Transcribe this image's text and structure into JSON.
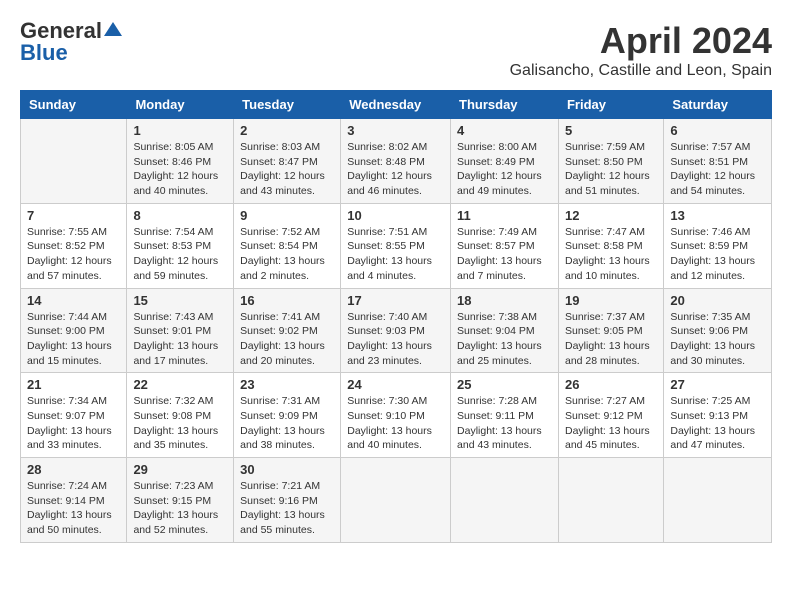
{
  "header": {
    "logo_general": "General",
    "logo_blue": "Blue",
    "month": "April 2024",
    "location": "Galisancho, Castille and Leon, Spain"
  },
  "days_of_week": [
    "Sunday",
    "Monday",
    "Tuesday",
    "Wednesday",
    "Thursday",
    "Friday",
    "Saturday"
  ],
  "weeks": [
    [
      {
        "day": "",
        "info": ""
      },
      {
        "day": "1",
        "info": "Sunrise: 8:05 AM\nSunset: 8:46 PM\nDaylight: 12 hours\nand 40 minutes."
      },
      {
        "day": "2",
        "info": "Sunrise: 8:03 AM\nSunset: 8:47 PM\nDaylight: 12 hours\nand 43 minutes."
      },
      {
        "day": "3",
        "info": "Sunrise: 8:02 AM\nSunset: 8:48 PM\nDaylight: 12 hours\nand 46 minutes."
      },
      {
        "day": "4",
        "info": "Sunrise: 8:00 AM\nSunset: 8:49 PM\nDaylight: 12 hours\nand 49 minutes."
      },
      {
        "day": "5",
        "info": "Sunrise: 7:59 AM\nSunset: 8:50 PM\nDaylight: 12 hours\nand 51 minutes."
      },
      {
        "day": "6",
        "info": "Sunrise: 7:57 AM\nSunset: 8:51 PM\nDaylight: 12 hours\nand 54 minutes."
      }
    ],
    [
      {
        "day": "7",
        "info": "Sunrise: 7:55 AM\nSunset: 8:52 PM\nDaylight: 12 hours\nand 57 minutes."
      },
      {
        "day": "8",
        "info": "Sunrise: 7:54 AM\nSunset: 8:53 PM\nDaylight: 12 hours\nand 59 minutes."
      },
      {
        "day": "9",
        "info": "Sunrise: 7:52 AM\nSunset: 8:54 PM\nDaylight: 13 hours\nand 2 minutes."
      },
      {
        "day": "10",
        "info": "Sunrise: 7:51 AM\nSunset: 8:55 PM\nDaylight: 13 hours\nand 4 minutes."
      },
      {
        "day": "11",
        "info": "Sunrise: 7:49 AM\nSunset: 8:57 PM\nDaylight: 13 hours\nand 7 minutes."
      },
      {
        "day": "12",
        "info": "Sunrise: 7:47 AM\nSunset: 8:58 PM\nDaylight: 13 hours\nand 10 minutes."
      },
      {
        "day": "13",
        "info": "Sunrise: 7:46 AM\nSunset: 8:59 PM\nDaylight: 13 hours\nand 12 minutes."
      }
    ],
    [
      {
        "day": "14",
        "info": "Sunrise: 7:44 AM\nSunset: 9:00 PM\nDaylight: 13 hours\nand 15 minutes."
      },
      {
        "day": "15",
        "info": "Sunrise: 7:43 AM\nSunset: 9:01 PM\nDaylight: 13 hours\nand 17 minutes."
      },
      {
        "day": "16",
        "info": "Sunrise: 7:41 AM\nSunset: 9:02 PM\nDaylight: 13 hours\nand 20 minutes."
      },
      {
        "day": "17",
        "info": "Sunrise: 7:40 AM\nSunset: 9:03 PM\nDaylight: 13 hours\nand 23 minutes."
      },
      {
        "day": "18",
        "info": "Sunrise: 7:38 AM\nSunset: 9:04 PM\nDaylight: 13 hours\nand 25 minutes."
      },
      {
        "day": "19",
        "info": "Sunrise: 7:37 AM\nSunset: 9:05 PM\nDaylight: 13 hours\nand 28 minutes."
      },
      {
        "day": "20",
        "info": "Sunrise: 7:35 AM\nSunset: 9:06 PM\nDaylight: 13 hours\nand 30 minutes."
      }
    ],
    [
      {
        "day": "21",
        "info": "Sunrise: 7:34 AM\nSunset: 9:07 PM\nDaylight: 13 hours\nand 33 minutes."
      },
      {
        "day": "22",
        "info": "Sunrise: 7:32 AM\nSunset: 9:08 PM\nDaylight: 13 hours\nand 35 minutes."
      },
      {
        "day": "23",
        "info": "Sunrise: 7:31 AM\nSunset: 9:09 PM\nDaylight: 13 hours\nand 38 minutes."
      },
      {
        "day": "24",
        "info": "Sunrise: 7:30 AM\nSunset: 9:10 PM\nDaylight: 13 hours\nand 40 minutes."
      },
      {
        "day": "25",
        "info": "Sunrise: 7:28 AM\nSunset: 9:11 PM\nDaylight: 13 hours\nand 43 minutes."
      },
      {
        "day": "26",
        "info": "Sunrise: 7:27 AM\nSunset: 9:12 PM\nDaylight: 13 hours\nand 45 minutes."
      },
      {
        "day": "27",
        "info": "Sunrise: 7:25 AM\nSunset: 9:13 PM\nDaylight: 13 hours\nand 47 minutes."
      }
    ],
    [
      {
        "day": "28",
        "info": "Sunrise: 7:24 AM\nSunset: 9:14 PM\nDaylight: 13 hours\nand 50 minutes."
      },
      {
        "day": "29",
        "info": "Sunrise: 7:23 AM\nSunset: 9:15 PM\nDaylight: 13 hours\nand 52 minutes."
      },
      {
        "day": "30",
        "info": "Sunrise: 7:21 AM\nSunset: 9:16 PM\nDaylight: 13 hours\nand 55 minutes."
      },
      {
        "day": "",
        "info": ""
      },
      {
        "day": "",
        "info": ""
      },
      {
        "day": "",
        "info": ""
      },
      {
        "day": "",
        "info": ""
      }
    ]
  ]
}
